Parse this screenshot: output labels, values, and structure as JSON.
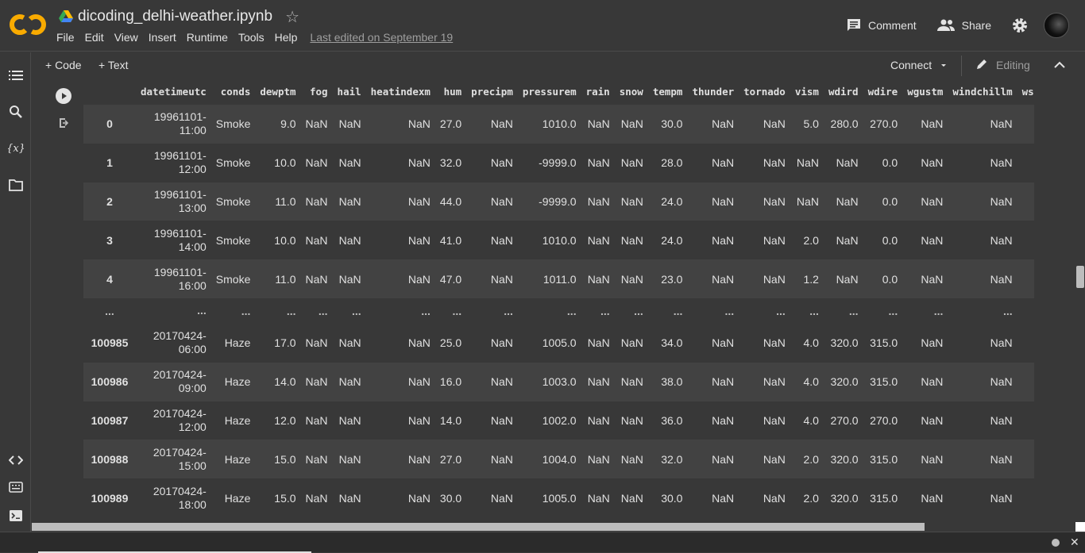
{
  "header": {
    "notebook_title": "dicoding_delhi-weather.ipynb",
    "menu": [
      "File",
      "Edit",
      "View",
      "Insert",
      "Runtime",
      "Tools",
      "Help"
    ],
    "last_edited": "Last edited on September 19",
    "comment_label": "Comment",
    "share_label": "Share"
  },
  "toolbar": {
    "code_label": "+ Code",
    "text_label": "+ Text",
    "connect_label": "Connect",
    "editing_label": "Editing"
  },
  "colors": {
    "logo_orange": "#f9ab00",
    "background": "#383838",
    "row_alt": "#424242"
  },
  "icons": {
    "sidebar": [
      "toc-icon",
      "search-icon",
      "variables-icon",
      "folder-icon",
      "code-snippets-icon",
      "command-palette-icon",
      "terminal-icon"
    ]
  },
  "dataframe": {
    "columns": [
      "",
      "datetimeutc",
      "conds",
      "dewptm",
      "fog",
      "hail",
      "heatindexm",
      "hum",
      "precipm",
      "pressurem",
      "rain",
      "snow",
      "tempm",
      "thunder",
      "tornado",
      "vism",
      "wdird",
      "wdire",
      "wgustm",
      "windchillm",
      "wspdm"
    ],
    "rows": [
      [
        "0",
        "19961101-11:00",
        "Smoke",
        "9.0",
        "NaN",
        "NaN",
        "NaN",
        "27.0",
        "NaN",
        "1010.0",
        "NaN",
        "NaN",
        "30.0",
        "NaN",
        "NaN",
        "5.0",
        "280.0",
        "270.0",
        "NaN",
        "NaN",
        ""
      ],
      [
        "1",
        "19961101-12:00",
        "Smoke",
        "10.0",
        "NaN",
        "NaN",
        "NaN",
        "32.0",
        "NaN",
        "-9999.0",
        "NaN",
        "NaN",
        "28.0",
        "NaN",
        "NaN",
        "NaN",
        "NaN",
        "0.0",
        "NaN",
        "NaN",
        ""
      ],
      [
        "2",
        "19961101-13:00",
        "Smoke",
        "11.0",
        "NaN",
        "NaN",
        "NaN",
        "44.0",
        "NaN",
        "-9999.0",
        "NaN",
        "NaN",
        "24.0",
        "NaN",
        "NaN",
        "NaN",
        "NaN",
        "0.0",
        "NaN",
        "NaN",
        ""
      ],
      [
        "3",
        "19961101-14:00",
        "Smoke",
        "10.0",
        "NaN",
        "NaN",
        "NaN",
        "41.0",
        "NaN",
        "1010.0",
        "NaN",
        "NaN",
        "24.0",
        "NaN",
        "NaN",
        "2.0",
        "NaN",
        "0.0",
        "NaN",
        "NaN",
        ""
      ],
      [
        "4",
        "19961101-16:00",
        "Smoke",
        "11.0",
        "NaN",
        "NaN",
        "NaN",
        "47.0",
        "NaN",
        "1011.0",
        "NaN",
        "NaN",
        "23.0",
        "NaN",
        "NaN",
        "1.2",
        "NaN",
        "0.0",
        "NaN",
        "NaN",
        ""
      ],
      [
        "...",
        "...",
        "...",
        "...",
        "...",
        "...",
        "...",
        "...",
        "...",
        "...",
        "...",
        "...",
        "...",
        "...",
        "...",
        "...",
        "...",
        "...",
        "...",
        "...",
        ""
      ],
      [
        "100985",
        "20170424-06:00",
        "Haze",
        "17.0",
        "NaN",
        "NaN",
        "NaN",
        "25.0",
        "NaN",
        "1005.0",
        "NaN",
        "NaN",
        "34.0",
        "NaN",
        "NaN",
        "4.0",
        "320.0",
        "315.0",
        "NaN",
        "NaN",
        ""
      ],
      [
        "100986",
        "20170424-09:00",
        "Haze",
        "14.0",
        "NaN",
        "NaN",
        "NaN",
        "16.0",
        "NaN",
        "1003.0",
        "NaN",
        "NaN",
        "38.0",
        "NaN",
        "NaN",
        "4.0",
        "320.0",
        "315.0",
        "NaN",
        "NaN",
        ""
      ],
      [
        "100987",
        "20170424-12:00",
        "Haze",
        "12.0",
        "NaN",
        "NaN",
        "NaN",
        "14.0",
        "NaN",
        "1002.0",
        "NaN",
        "NaN",
        "36.0",
        "NaN",
        "NaN",
        "4.0",
        "270.0",
        "270.0",
        "NaN",
        "NaN",
        ""
      ],
      [
        "100988",
        "20170424-15:00",
        "Haze",
        "15.0",
        "NaN",
        "NaN",
        "NaN",
        "27.0",
        "NaN",
        "1004.0",
        "NaN",
        "NaN",
        "32.0",
        "NaN",
        "NaN",
        "2.0",
        "320.0",
        "315.0",
        "NaN",
        "NaN",
        ""
      ],
      [
        "100989",
        "20170424-18:00",
        "Haze",
        "15.0",
        "NaN",
        "NaN",
        "NaN",
        "30.0",
        "NaN",
        "1005.0",
        "NaN",
        "NaN",
        "30.0",
        "NaN",
        "NaN",
        "2.0",
        "320.0",
        "315.0",
        "NaN",
        "NaN",
        ""
      ]
    ]
  }
}
